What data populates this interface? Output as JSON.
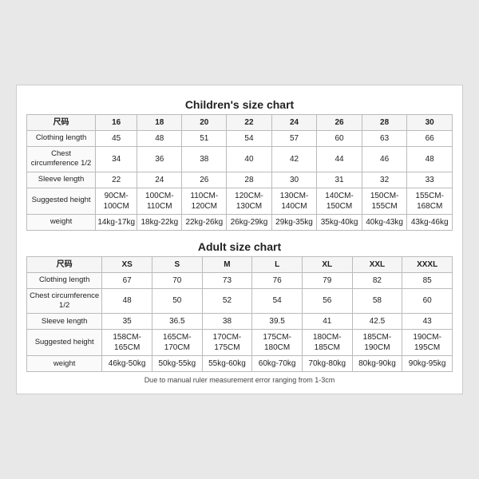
{
  "children_chart": {
    "title": "Children's size chart",
    "headers": [
      "尺码",
      "16",
      "18",
      "20",
      "22",
      "24",
      "26",
      "28",
      "30"
    ],
    "rows": [
      {
        "label": "Clothing length",
        "values": [
          "45",
          "48",
          "51",
          "54",
          "57",
          "60",
          "63",
          "66"
        ]
      },
      {
        "label": "Chest circumference 1/2",
        "values": [
          "34",
          "36",
          "38",
          "40",
          "42",
          "44",
          "46",
          "48"
        ]
      },
      {
        "label": "Sleeve length",
        "values": [
          "22",
          "24",
          "26",
          "28",
          "30",
          "31",
          "32",
          "33"
        ]
      },
      {
        "label": "Suggested height",
        "values": [
          "90CM-100CM",
          "100CM-110CM",
          "110CM-120CM",
          "120CM-130CM",
          "130CM-140CM",
          "140CM-150CM",
          "150CM-155CM",
          "155CM-168CM"
        ]
      },
      {
        "label": "weight",
        "values": [
          "14kg-17kg",
          "18kg-22kg",
          "22kg-26kg",
          "26kg-29kg",
          "29kg-35kg",
          "35kg-40kg",
          "40kg-43kg",
          "43kg-46kg"
        ]
      }
    ]
  },
  "adult_chart": {
    "title": "Adult size chart",
    "headers": [
      "尺码",
      "XS",
      "S",
      "M",
      "L",
      "XL",
      "XXL",
      "XXXL"
    ],
    "rows": [
      {
        "label": "Clothing length",
        "values": [
          "67",
          "70",
          "73",
          "76",
          "79",
          "82",
          "85"
        ]
      },
      {
        "label": "Chest circumference 1/2",
        "values": [
          "48",
          "50",
          "52",
          "54",
          "56",
          "58",
          "60"
        ]
      },
      {
        "label": "Sleeve length",
        "values": [
          "35",
          "36.5",
          "38",
          "39.5",
          "41",
          "42.5",
          "43"
        ]
      },
      {
        "label": "Suggested height",
        "values": [
          "158CM-165CM",
          "165CM-170CM",
          "170CM-175CM",
          "175CM-180CM",
          "180CM-185CM",
          "185CM-190CM",
          "190CM-195CM"
        ]
      },
      {
        "label": "weight",
        "values": [
          "46kg-50kg",
          "50kg-55kg",
          "55kg-60kg",
          "60kg-70kg",
          "70kg-80kg",
          "80kg-90kg",
          "90kg-95kg"
        ]
      }
    ]
  },
  "footer": {
    "note": "Due to manual ruler measurement error ranging from 1-3cm"
  }
}
